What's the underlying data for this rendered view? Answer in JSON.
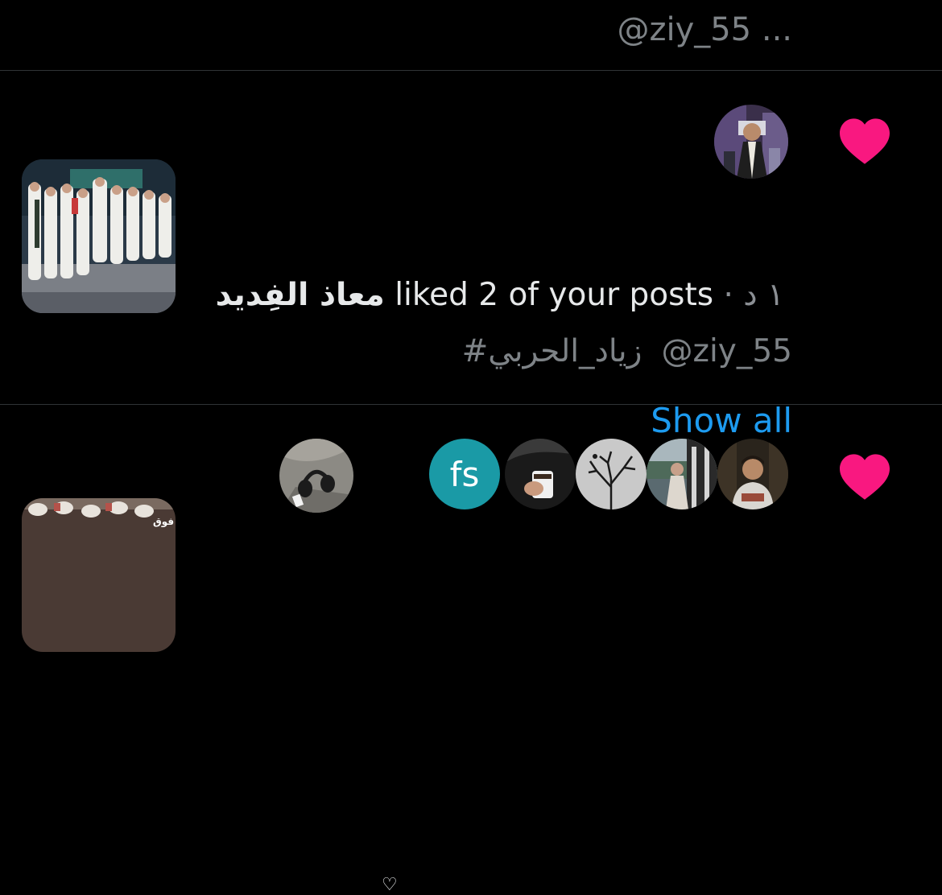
{
  "top_item": {
    "handle_text": "@ziy_55 ..."
  },
  "notification_1": {
    "actor": "معاذ الفِديد",
    "action": " liked 2 of your posts",
    "time": " · ١ د",
    "post_handle": "@ziy_55",
    "post_hashtag": "#زياد_الحربي",
    "show_all_label": "Show all",
    "heart_icon": "heart-filled",
    "heart_color": "#f91880"
  },
  "notification_2": {
    "separator_icon": "♡",
    "fs_avatar_text": "fs",
    "thumb_label": "فوق",
    "heart_color": "#f91880"
  },
  "colors": {
    "background": "#000000",
    "link": "#1d9bf0",
    "divider": "#2f3336",
    "secondary_text": "#7e8387"
  }
}
